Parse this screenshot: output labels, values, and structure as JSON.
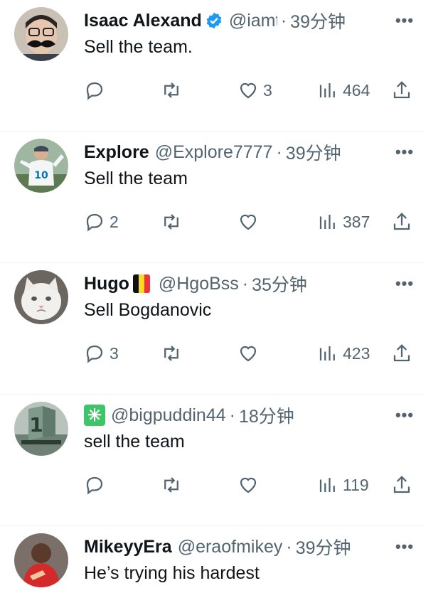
{
  "tweets": [
    {
      "name": "Isaac Alexand",
      "handle": "@iamt",
      "separator": "·",
      "time": "39分钟",
      "text": "Sell the team.",
      "reply_count": "",
      "like_count": "3",
      "view_count": "464",
      "badge": "verified",
      "avatar": "avatar-man-mustache"
    },
    {
      "name": "Explore",
      "handle": "@Explore7777",
      "separator": "·",
      "time": "39分钟",
      "text": "Sell the team",
      "reply_count": "2",
      "like_count": "",
      "view_count": "387",
      "badge": "",
      "avatar": "avatar-football-player",
      "jersey_number": "10"
    },
    {
      "name": "Hugo",
      "handle": "@HgoBss",
      "separator": "·",
      "time": "35分钟",
      "text": "Sell Bogdanovic",
      "reply_count": "3",
      "like_count": "",
      "view_count": "423",
      "badge": "belgium-flag",
      "avatar": "avatar-white-cat"
    },
    {
      "name": "",
      "handle": "@bigpuddin44",
      "separator": "·",
      "time": "18分钟",
      "text": "sell the team",
      "reply_count": "",
      "like_count": "",
      "view_count": "119",
      "badge": "sparkle",
      "avatar": "avatar-number-one-building"
    },
    {
      "name": "MikeyyEra",
      "handle": "@eraofmikey",
      "separator": "·",
      "time": "39分钟",
      "text": "He’s trying his hardest",
      "avatar": "avatar-person-red"
    }
  ],
  "icons": {
    "reply": "reply-icon",
    "retweet": "retweet-icon",
    "like": "like-icon",
    "views": "views-icon",
    "share": "share-icon",
    "more": "more-icon"
  },
  "colors": {
    "text_primary": "#0f1419",
    "text_secondary": "#536471",
    "verified_blue": "#1d9bf0",
    "divider": "#eff3f4"
  }
}
